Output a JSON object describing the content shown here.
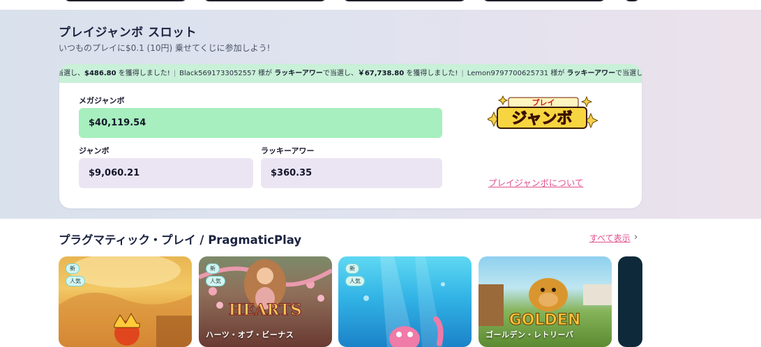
{
  "jumbo": {
    "title": "プレイジャンボ スロット",
    "subtitle": "いつものプレイに$0.1 (10円) 乗せてくじに参加しよう!",
    "ticker": {
      "item1_prefix": "当選し、",
      "item1_amount": "$486.80",
      "item1_suffix": " を獲得しました!",
      "item2_user": "Black5691733052557",
      "item2_mid1": " 様が ",
      "item2_prize": "ラッキーアワー",
      "item2_mid2": "で当選し、",
      "item2_amount": "￥67,738.80",
      "item2_suffix": " を獲得しました!",
      "item3_user": "Lemon9797700625731",
      "item3_mid1": " 様が ",
      "item3_prize": "ラッキーアワー",
      "item3_mid2": "で当選し、"
    },
    "mega_label": "メガジャンボ",
    "mega_value": "$40,119.54",
    "jumbo_label": "ジャンボ",
    "jumbo_value": "$9,060.21",
    "lucky_label": "ラッキーアワー",
    "lucky_value": "$360.35",
    "logo_text_top": "プレイ",
    "logo_text_main": "ジャンボ",
    "about_link": "プレイジャンボについて"
  },
  "provider": {
    "title": "プラグマティック・プレイ / PragmaticPlay",
    "show_all": "すべて表示",
    "games": [
      {
        "badge_new": "新",
        "badge_popular": "人気",
        "name": ""
      },
      {
        "badge_new": "新",
        "badge_popular": "人気",
        "name": "ハーツ・オブ・ビーナス",
        "art_text": "HEARTS"
      },
      {
        "badge_new": "新",
        "badge_popular": "人気",
        "name": ""
      },
      {
        "badge_new": "",
        "badge_popular": "",
        "name": "ゴールデン・レトリーバ",
        "art_text": "GOLDEN"
      }
    ]
  },
  "colors": {
    "accent_pink": "#e0508c",
    "mega_green": "#a7efbe",
    "ticker_green": "#c9f0d8",
    "field_lavender": "#ebe5f3"
  }
}
